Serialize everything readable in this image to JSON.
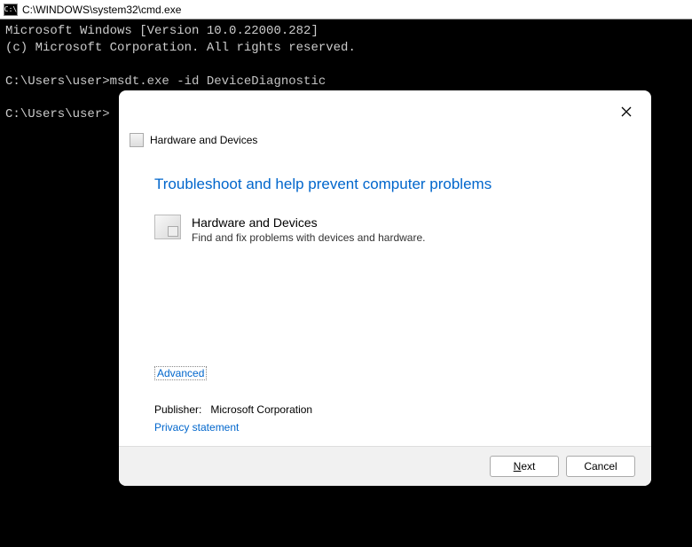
{
  "cmd": {
    "titlebar": "C:\\WINDOWS\\system32\\cmd.exe",
    "line1": "Microsoft Windows [Version 10.0.22000.282]",
    "line2": "(c) Microsoft Corporation. All rights reserved.",
    "prompt1": "C:\\Users\\user>msdt.exe -id DeviceDiagnostic",
    "prompt2": "C:\\Users\\user>"
  },
  "dialog": {
    "header_title": "Hardware and Devices",
    "main_heading": "Troubleshoot and help prevent computer problems",
    "item_title": "Hardware and Devices",
    "item_desc": "Find and fix problems with devices and hardware.",
    "advanced": "Advanced",
    "publisher_label": "Publisher:",
    "publisher_value": "Microsoft Corporation",
    "privacy": "Privacy statement",
    "next_pre": "",
    "next_accel": "N",
    "next_post": "ext",
    "cancel": "Cancel"
  }
}
